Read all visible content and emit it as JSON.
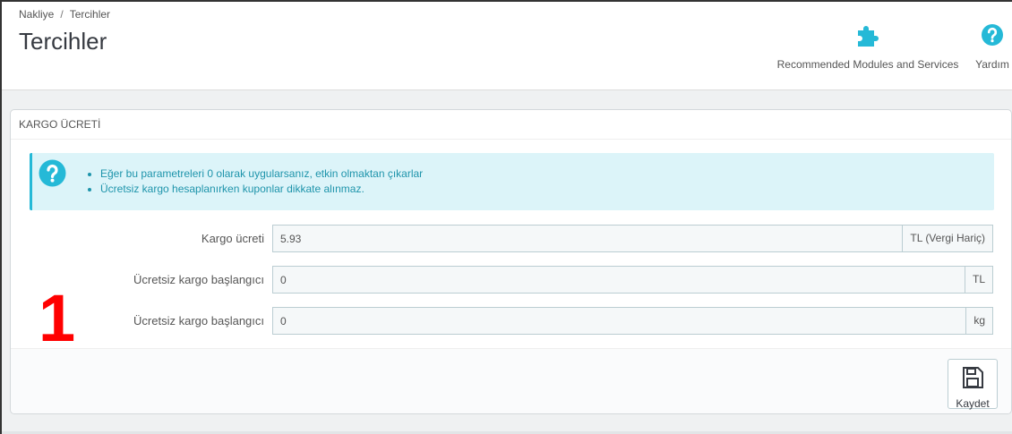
{
  "breadcrumb": {
    "parent": "Nakliye",
    "separator": "/",
    "current": "Tercihler"
  },
  "page_title": "Tercihler",
  "toolbar": {
    "modules_label": "Recommended Modules and Services",
    "help_label": "Yardım"
  },
  "panel": {
    "heading": "KARGO ÜCRETİ",
    "alert_items": [
      "Eğer bu parametreleri 0 olarak uygularsanız, etkin olmaktan çıkarlar",
      "Ücretsiz kargo hesaplanırken kuponlar dikkate alınmaz."
    ],
    "annotation_number": "1",
    "fields": [
      {
        "label": "Kargo ücreti",
        "value": "5.93",
        "addon": "TL (Vergi Hariç)"
      },
      {
        "label": "Ücretsiz kargo başlangıcı",
        "value": "0",
        "addon": "TL"
      },
      {
        "label": "Ücretsiz kargo başlangıcı",
        "value": "0",
        "addon": "kg"
      }
    ],
    "save_label": "Kaydet"
  },
  "colors": {
    "accent": "#25b9d7",
    "alert_bg": "#dcf4f9",
    "alert_text": "#1e94ab",
    "annotation": "#ff0000"
  },
  "icons": {
    "modules": "puzzle-icon",
    "help": "help-circle-icon",
    "alert": "question-circle-icon",
    "save": "floppy-disk-icon"
  }
}
